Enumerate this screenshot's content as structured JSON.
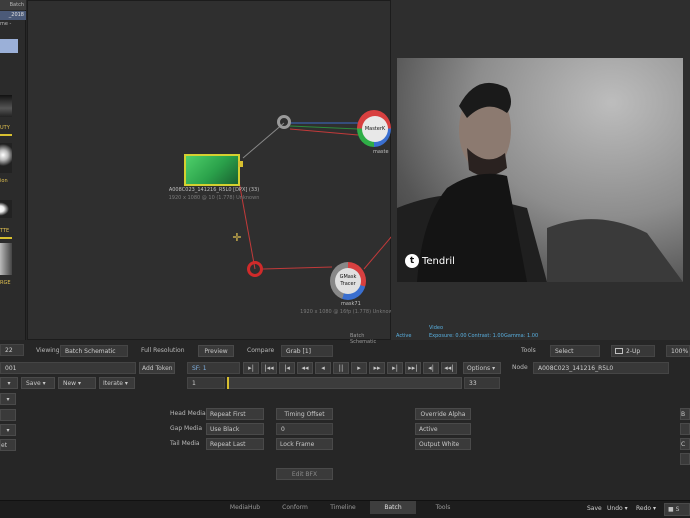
{
  "left_panel": {
    "tab_label": "Batch",
    "title": "_2018",
    "sub": "me -",
    "thumb_labels": [
      "UTY",
      "ion",
      "TTE",
      "RGE"
    ]
  },
  "schematic": {
    "source_node": {
      "name": "A008C023_141216_R5L0 [DPX] (33)",
      "info": "1920 x 1080 @ 10 (1.778) Unknown"
    },
    "masterk_node": {
      "label": "MasterK",
      "sub": "maste"
    },
    "gmask_node": {
      "label": "GMask Tracer",
      "name": "mask71",
      "info": "1920 x 1080 @ 16fp (1.778) Unknown"
    },
    "footer_label": "Batch Schematic"
  },
  "viewer": {
    "logo_text": "Tendril",
    "status": {
      "active": "Active",
      "video": "Video",
      "exposure": "Exposure: 0.00",
      "contrast": "Contrast: 1.00",
      "gamma": "Gamma: 1.00"
    }
  },
  "view_bar": {
    "left_value": "22",
    "viewing_label": "Viewing",
    "viewing_value": "Batch Schematic",
    "full_res_label": "Full Resolution",
    "preview_label": "Preview",
    "compare_label": "Compare",
    "compare_value": "Grab [1]",
    "tools_label": "Tools",
    "tools_value": "Select",
    "layout_value": "2-Up",
    "right_value": "100%"
  },
  "transport": {
    "left_field": "001",
    "add_token_label": "Add Token",
    "save_label": "Save",
    "new_label": "New",
    "iterate_label": "Iterate",
    "sf_field": "SF: 1",
    "start_frame": "1",
    "end_frame": "33",
    "options_label": "Options",
    "node_label": "Node",
    "node_value": "A008C023_141216_R5L0",
    "buttons": [
      "▸|",
      "|◂◂",
      "|◂",
      "◂◂",
      "◂",
      "||",
      "▸",
      "▸▸",
      "▸|",
      "▸▸|",
      "◂|"
    ]
  },
  "media": {
    "head_label": "Head Media",
    "head_value": "Repeat First",
    "gap_label": "Gap Media",
    "gap_value": "Use Black",
    "tail_label": "Tail Media",
    "tail_value": "Repeat Last",
    "timing_offset_label": "Timing Offset",
    "timing_offset_value": "0",
    "lock_frame_label": "Lock Frame",
    "override_alpha_label": "Override Alpha",
    "active_label": "Active",
    "output_white_label": "Output White",
    "edit_bfx_label": "Edit BFX"
  },
  "bottom_tabs": [
    "MediaHub",
    "Conform",
    "Timeline",
    "Batch",
    "Tools"
  ],
  "bottom_right": {
    "save_label": "Save",
    "undo_label": "Undo",
    "redo_label": "Redo"
  }
}
